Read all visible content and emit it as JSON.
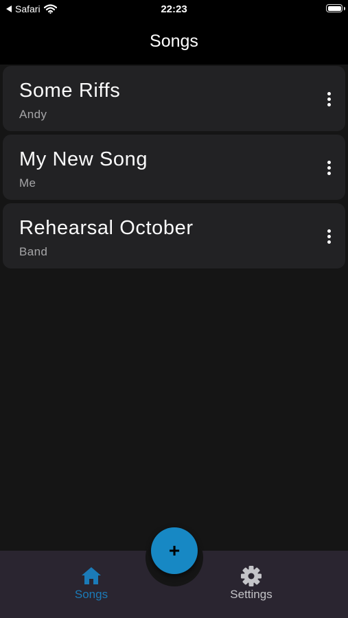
{
  "status_bar": {
    "back_app": "Safari",
    "time": "22:23"
  },
  "header": {
    "title": "Songs"
  },
  "songs": [
    {
      "title": "Some Riffs",
      "artist": "Andy"
    },
    {
      "title": "My New Song",
      "artist": "Me"
    },
    {
      "title": "Rehearsal October",
      "artist": "Band"
    }
  ],
  "fab": {
    "icon": "plus-icon",
    "label": "+"
  },
  "tabs": [
    {
      "label": "Songs",
      "icon": "home-icon",
      "active": true,
      "color": "#1b7bb8"
    },
    {
      "label": "Settings",
      "icon": "gear-icon",
      "active": false,
      "color": "#c4c4c8"
    }
  ],
  "colors": {
    "accent": "#1788c4",
    "card_background": "#222224",
    "screen_background": "#151515",
    "bottom_bar": "#2a2530"
  }
}
